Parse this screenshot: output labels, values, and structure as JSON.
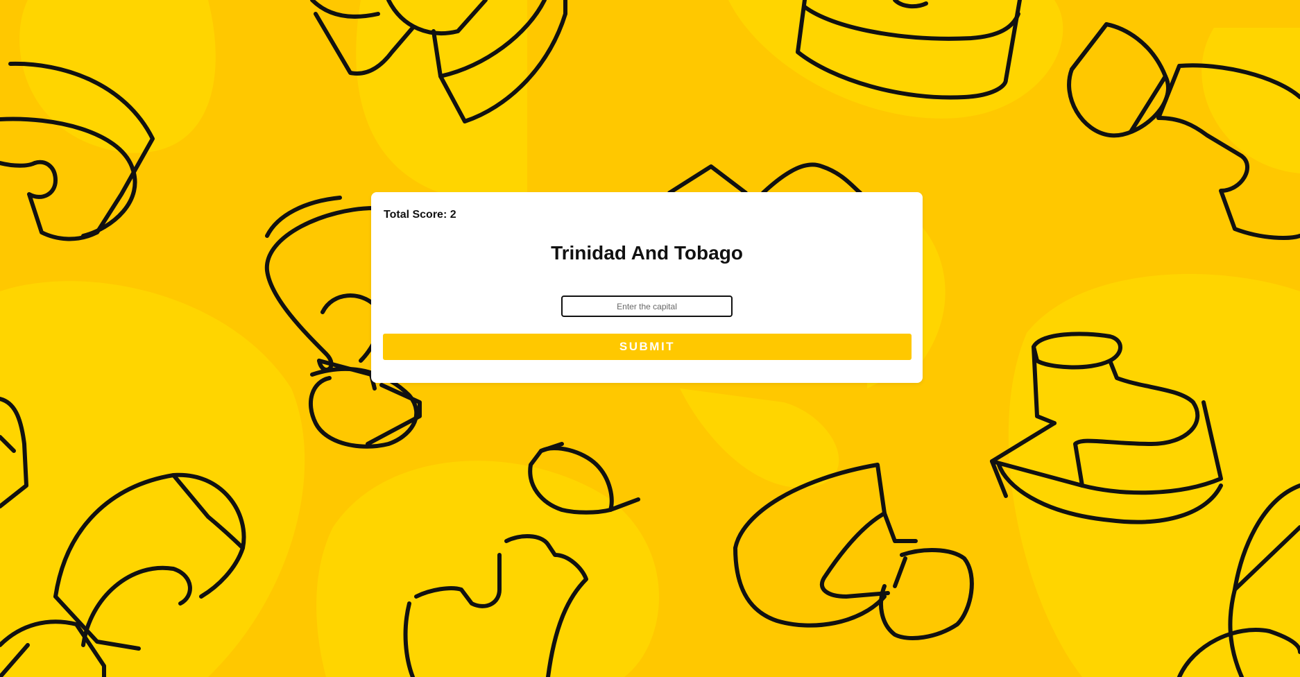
{
  "colors": {
    "background": "#ffc800",
    "background_blob": "#ffd500",
    "outline": "#111111",
    "card": "#ffffff",
    "button": "#ffc800",
    "button_text": "#ffffff"
  },
  "quiz": {
    "score_label": "Total Score: 2",
    "country": "Trinidad And Tobago",
    "input_placeholder": "Enter the capital",
    "input_value": "",
    "submit_label": "SUBMIT"
  },
  "background": {
    "pattern_icon": "question-mark-pattern"
  }
}
